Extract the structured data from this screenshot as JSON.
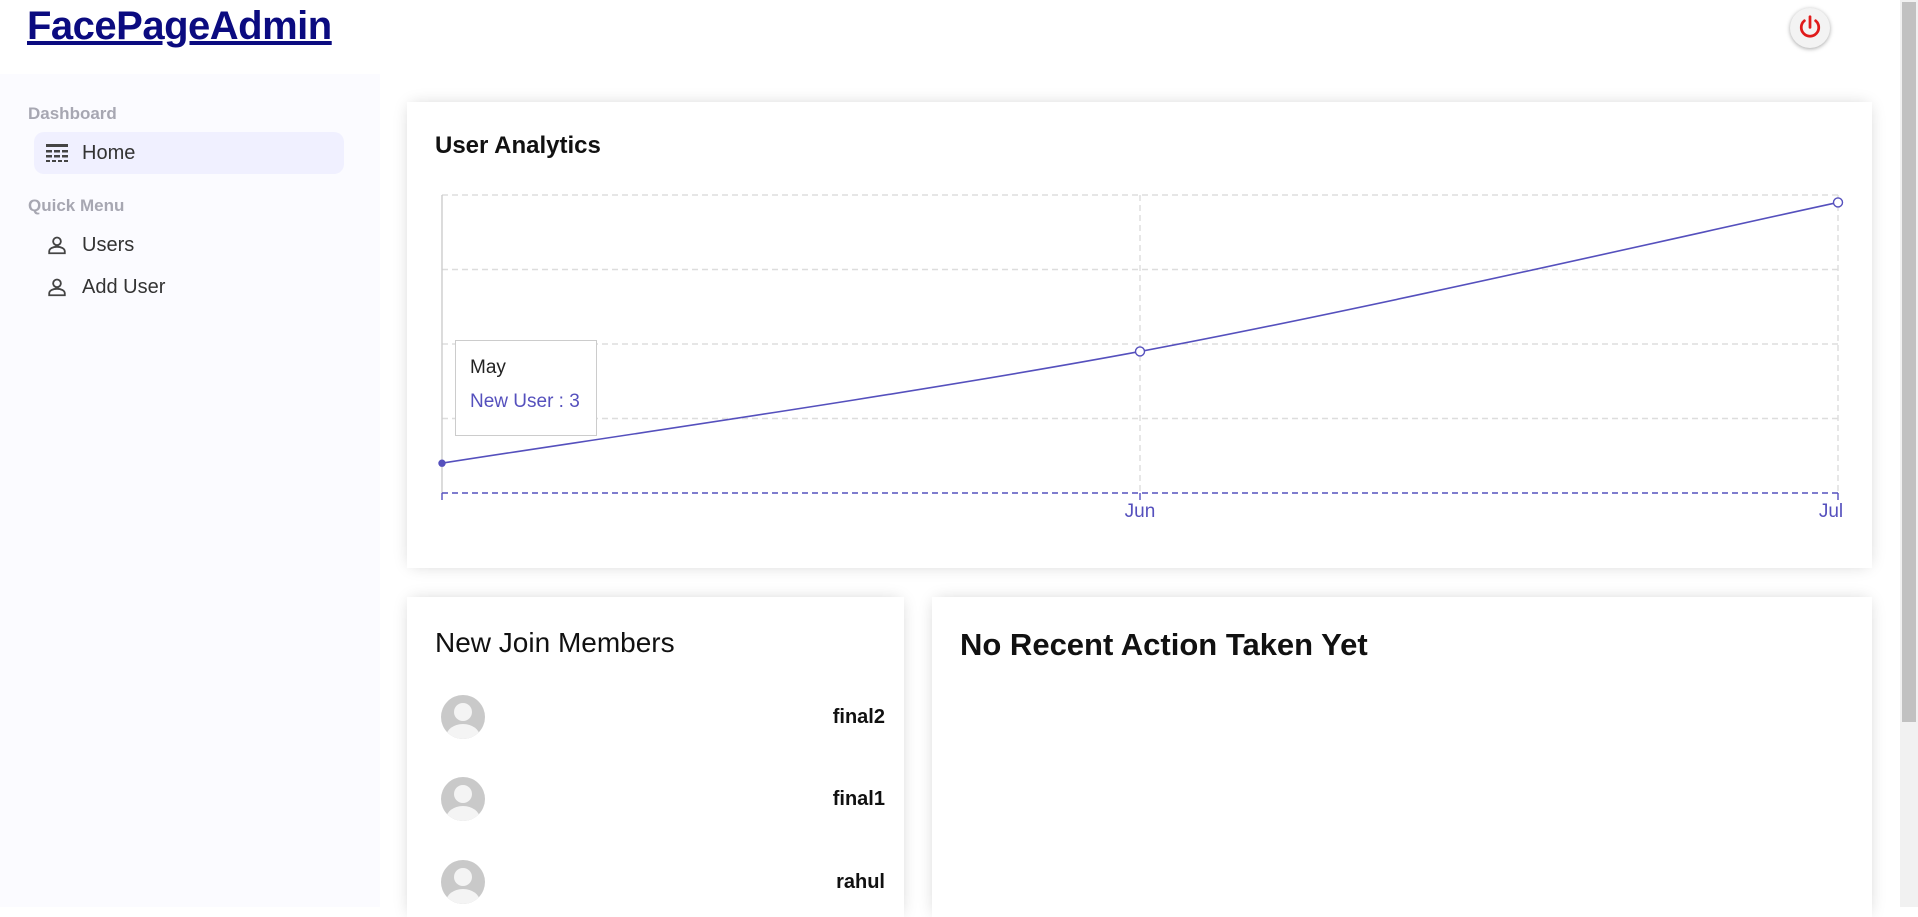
{
  "app": {
    "logo": "FacePageAdmin"
  },
  "sidebar": {
    "sections": [
      {
        "title": "Dashboard",
        "items": [
          {
            "label": "Home",
            "icon": "home-icon",
            "active": true
          }
        ]
      },
      {
        "title": "Quick Menu",
        "items": [
          {
            "label": "Users",
            "icon": "user-icon"
          },
          {
            "label": "Add User",
            "icon": "user-icon"
          }
        ]
      }
    ]
  },
  "analytics": {
    "title": "User Analytics",
    "tooltip": {
      "label": "May",
      "value": "New User : 3"
    }
  },
  "chart_data": {
    "type": "line",
    "categories": [
      "May",
      "Jun",
      "Jul"
    ],
    "series": [
      {
        "name": "New User",
        "values": [
          3,
          4.5,
          6.5
        ]
      }
    ],
    "tick_labels": [
      "",
      "Jun",
      "Jul"
    ],
    "ylim": [
      2.6,
      6.6
    ],
    "grid": true,
    "colors": {
      "line": "#5550bd",
      "grid": "#dddddd"
    }
  },
  "members": {
    "title": "New Join Members",
    "list": [
      {
        "name": "final2"
      },
      {
        "name": "final1"
      },
      {
        "name": "rahul"
      }
    ]
  },
  "actions": {
    "title": "No Recent Action Taken Yet"
  }
}
